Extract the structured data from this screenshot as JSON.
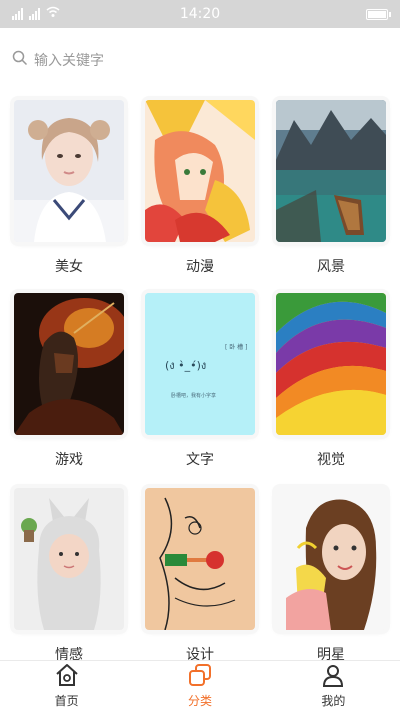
{
  "status": {
    "time": "14:20",
    "carrier": "fill fill"
  },
  "search": {
    "placeholder": "输入关键字"
  },
  "categories": [
    {
      "label": "美女"
    },
    {
      "label": "动漫"
    },
    {
      "label": "风景"
    },
    {
      "label": "游戏"
    },
    {
      "label": "文字",
      "card_tag": "[ 卧 槽 ]",
      "card_face": "(ง •̀_•́)ง",
      "card_caption": "卧槽吧，我有小字享"
    },
    {
      "label": "视觉"
    },
    {
      "label": "情感"
    },
    {
      "label": "设计"
    },
    {
      "label": "明星"
    }
  ],
  "tabbar": {
    "items": [
      {
        "label": "首页",
        "icon": "home-icon"
      },
      {
        "label": "分类",
        "icon": "category-icon"
      },
      {
        "label": "我的",
        "icon": "profile-icon"
      }
    ],
    "active_index": 1
  },
  "colors": {
    "accent": "#f2702a",
    "status_bar": "#d6d6d6"
  }
}
